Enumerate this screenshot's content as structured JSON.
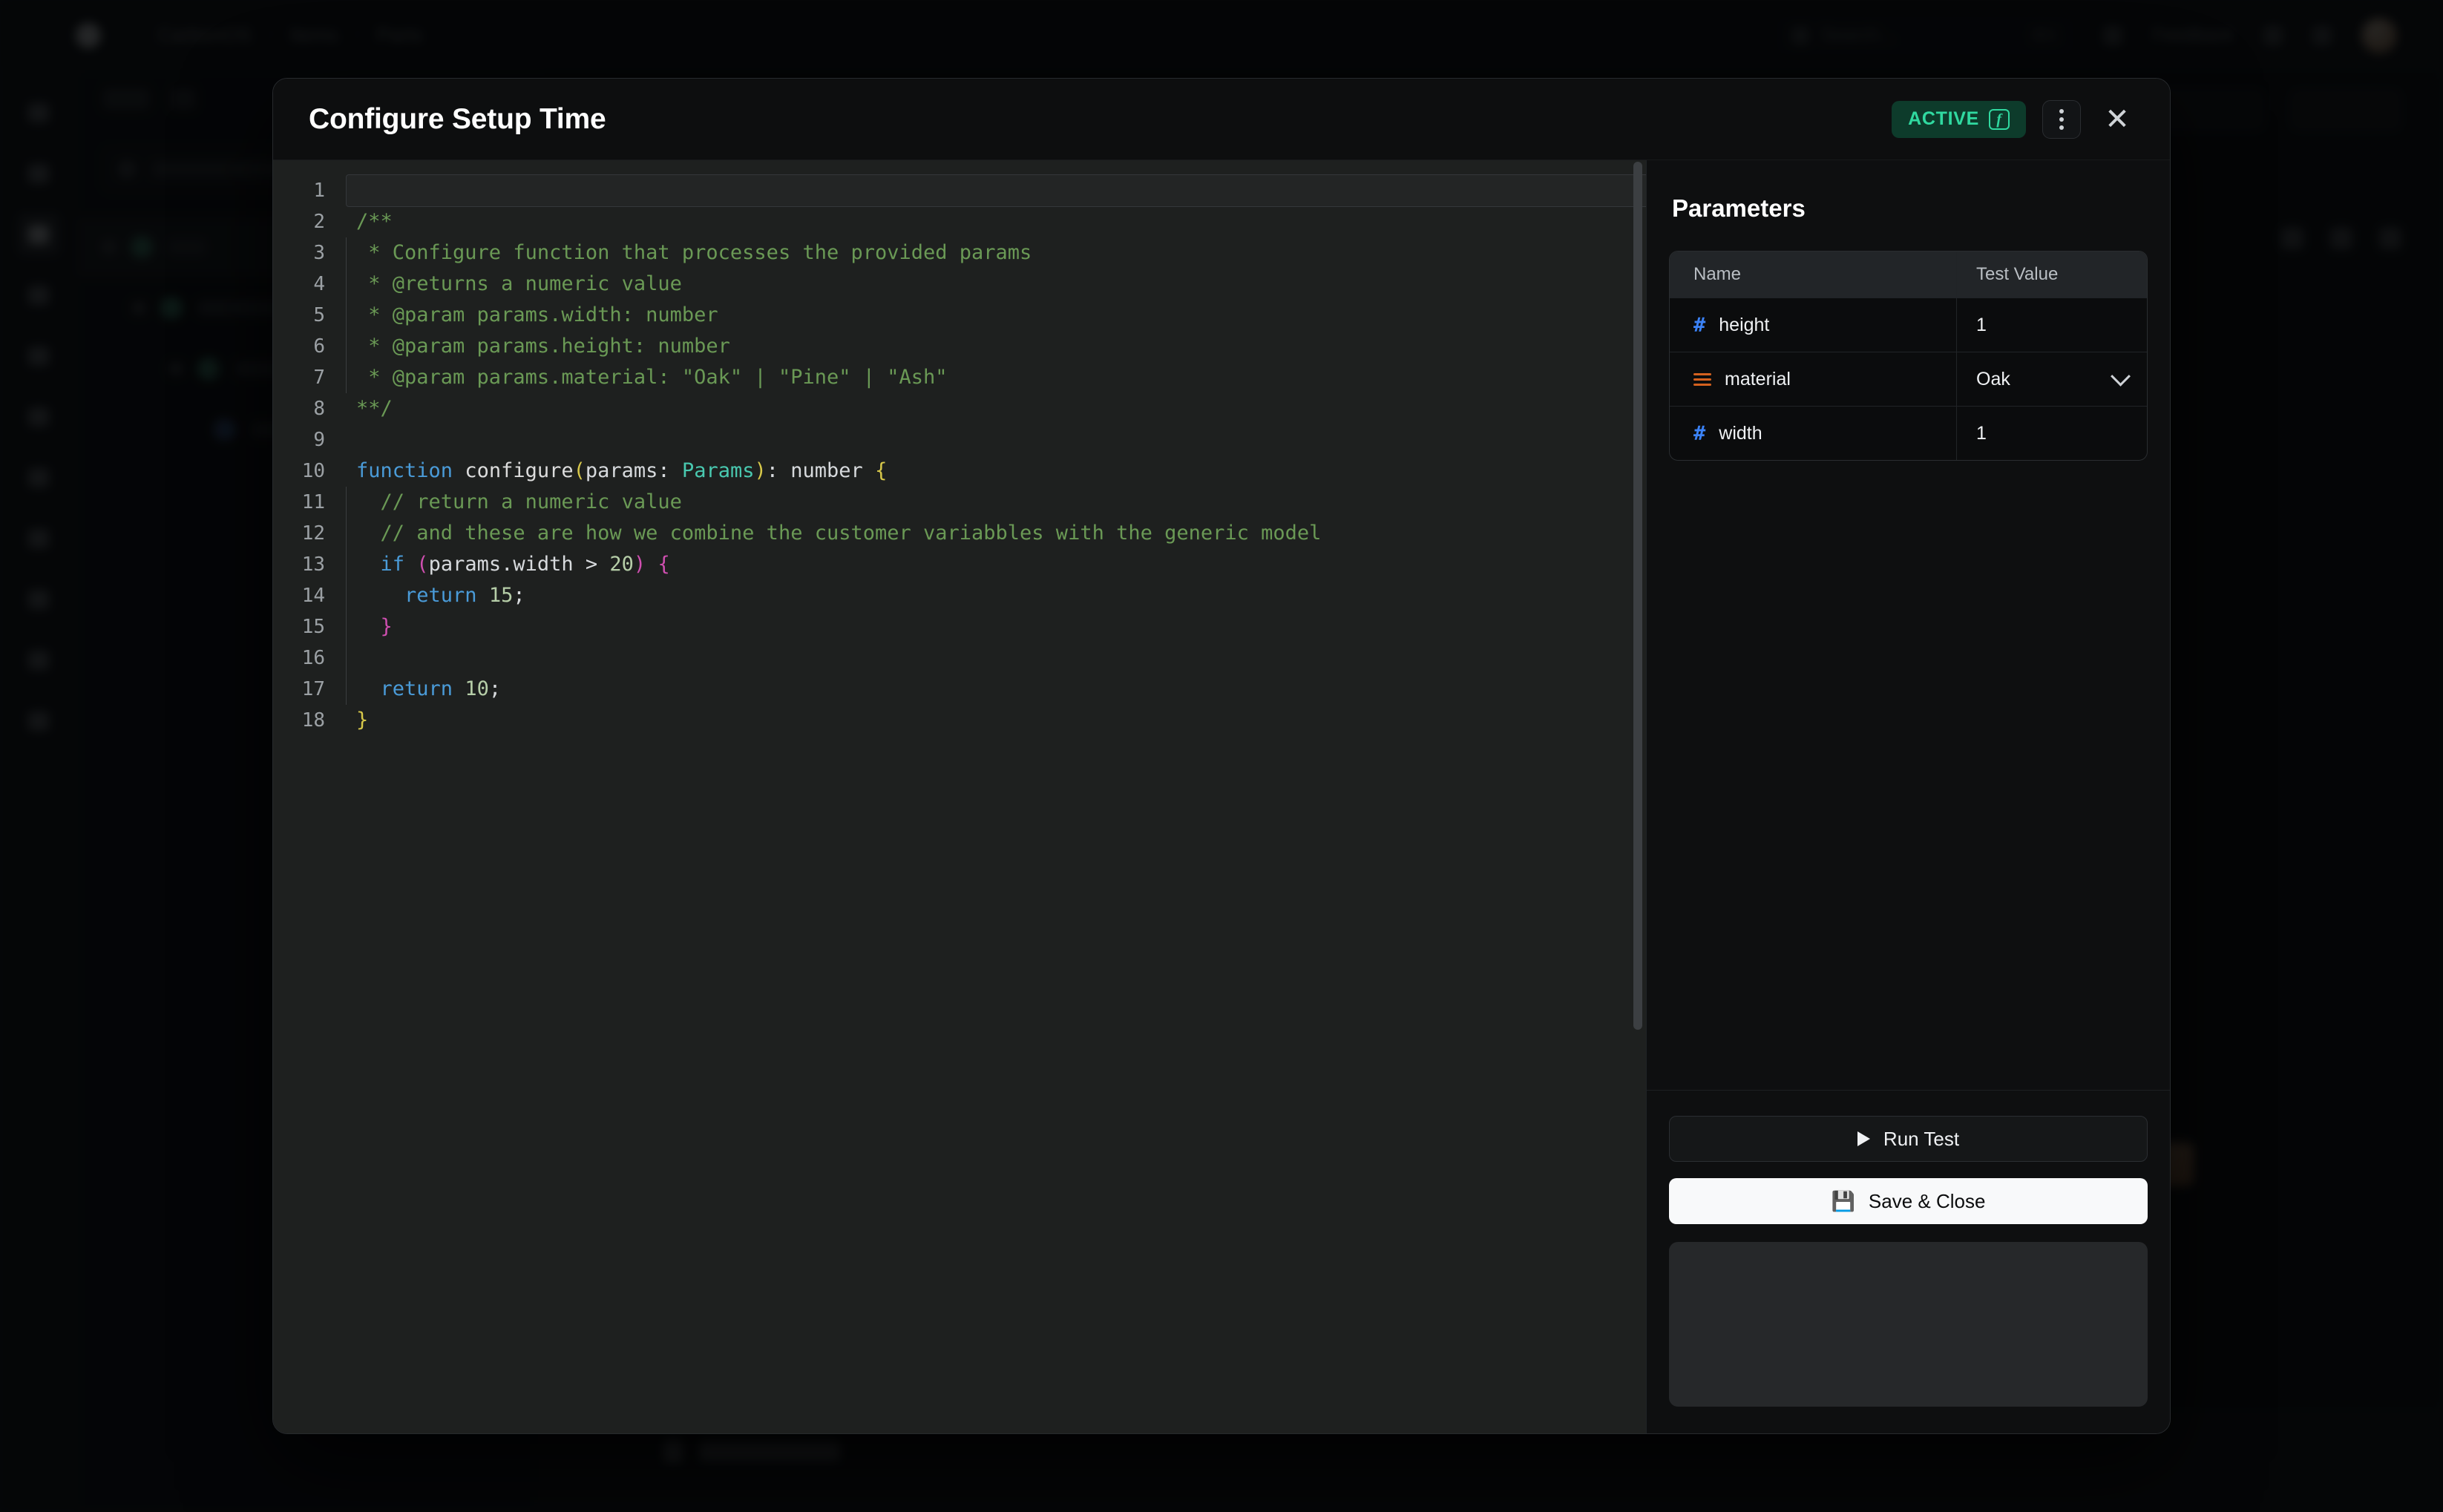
{
  "background": {
    "topbar": {
      "logo_icon": "app-logo-icon",
      "breadcrumbs": [
        "CarbonOS",
        "Items",
        "Parts"
      ],
      "separator": "/",
      "search_placeholder": "Search...",
      "search_shortcut": "⌘K",
      "feedback_label": "Feedback",
      "icons": [
        "notification-bell-icon",
        "help-circle-icon"
      ],
      "avatar": "user-avatar"
    },
    "rail_items": [
      "rail-item-1",
      "rail-item-2",
      "rail-item-3",
      "rail-item-4",
      "rail-item-5",
      "rail-item-6",
      "rail-item-7",
      "rail-item-8",
      "rail-item-9",
      "rail-item-10",
      "rail-item-11"
    ],
    "rail_active_index": 2,
    "panel": {
      "search_placeholder": "Search...",
      "tree_rows": 4
    },
    "bottombar": {
      "label": "Machine"
    }
  },
  "modal": {
    "title": "Configure Setup Time",
    "status_badge": {
      "label": "ACTIVE",
      "icon_glyph": "f",
      "color": "#30d9a0",
      "background": "#0d3b2b"
    },
    "menu_button": "more-options",
    "close_button": "close"
  },
  "editor": {
    "line_numbers": [
      1,
      2,
      3,
      4,
      5,
      6,
      7,
      8,
      9,
      10,
      11,
      12,
      13,
      14,
      15,
      16,
      17,
      18
    ],
    "active_line": 1,
    "lines": [
      {
        "n": 1,
        "indent": false,
        "tokens": []
      },
      {
        "n": 2,
        "indent": false,
        "tokens": [
          {
            "t": "/**",
            "c": "cmt"
          }
        ]
      },
      {
        "n": 3,
        "indent": true,
        "tokens": [
          {
            "t": " * Configure function that processes the provided params",
            "c": "cmt"
          }
        ]
      },
      {
        "n": 4,
        "indent": true,
        "tokens": [
          {
            "t": " * @returns a numeric value",
            "c": "cmt"
          }
        ]
      },
      {
        "n": 5,
        "indent": true,
        "tokens": [
          {
            "t": " * @param params.width: number",
            "c": "cmt"
          }
        ]
      },
      {
        "n": 6,
        "indent": true,
        "tokens": [
          {
            "t": " * @param params.height: number",
            "c": "cmt"
          }
        ]
      },
      {
        "n": 7,
        "indent": true,
        "tokens": [
          {
            "t": " * @param params.material: \"Oak\" | \"Pine\" | \"Ash\"",
            "c": "cmt"
          }
        ]
      },
      {
        "n": 8,
        "indent": false,
        "tokens": [
          {
            "t": "**/",
            "c": "cmt"
          }
        ]
      },
      {
        "n": 9,
        "indent": false,
        "tokens": []
      },
      {
        "n": 10,
        "indent": false,
        "tokens": [
          {
            "t": "function ",
            "c": "kw"
          },
          {
            "t": "configure",
            "c": "fnm"
          },
          {
            "t": "(",
            "c": "pun-y"
          },
          {
            "t": "params: ",
            "c": "plain"
          },
          {
            "t": "Params",
            "c": "typ"
          },
          {
            "t": ")",
            "c": "pun-y"
          },
          {
            "t": ": number ",
            "c": "plain"
          },
          {
            "t": "{",
            "c": "pun-y"
          }
        ]
      },
      {
        "n": 11,
        "indent": true,
        "tokens": [
          {
            "t": "  // return a numeric value",
            "c": "cmt"
          }
        ]
      },
      {
        "n": 12,
        "indent": true,
        "tokens": [
          {
            "t": "  // and these are how we combine the customer variabbles with the generic model",
            "c": "cmt"
          }
        ]
      },
      {
        "n": 13,
        "indent": true,
        "tokens": [
          {
            "t": "  ",
            "c": "plain"
          },
          {
            "t": "if ",
            "c": "kw"
          },
          {
            "t": "(",
            "c": "pun-p"
          },
          {
            "t": "params.width > ",
            "c": "plain"
          },
          {
            "t": "20",
            "c": "num"
          },
          {
            "t": ")",
            "c": "pun-p"
          },
          {
            "t": " ",
            "c": "plain"
          },
          {
            "t": "{",
            "c": "pun-p"
          }
        ]
      },
      {
        "n": 14,
        "indent": true,
        "tokens": [
          {
            "t": "    ",
            "c": "plain"
          },
          {
            "t": "return ",
            "c": "kw"
          },
          {
            "t": "15",
            "c": "num"
          },
          {
            "t": ";",
            "c": "plain"
          }
        ]
      },
      {
        "n": 15,
        "indent": true,
        "tokens": [
          {
            "t": "  ",
            "c": "plain"
          },
          {
            "t": "}",
            "c": "pun-p"
          }
        ]
      },
      {
        "n": 16,
        "indent": true,
        "tokens": []
      },
      {
        "n": 17,
        "indent": true,
        "tokens": [
          {
            "t": "  ",
            "c": "plain"
          },
          {
            "t": "return ",
            "c": "kw"
          },
          {
            "t": "10",
            "c": "num"
          },
          {
            "t": ";",
            "c": "plain"
          }
        ]
      },
      {
        "n": 18,
        "indent": false,
        "tokens": [
          {
            "t": "}",
            "c": "pun-y"
          }
        ]
      }
    ]
  },
  "parameters": {
    "heading": "Parameters",
    "columns": [
      "Name",
      "Test Value"
    ],
    "rows": [
      {
        "icon": "hash-icon",
        "type": "number",
        "name": "height",
        "value": "1",
        "control": "text"
      },
      {
        "icon": "list-icon",
        "type": "enum",
        "name": "material",
        "value": "Oak",
        "control": "select"
      },
      {
        "icon": "hash-icon",
        "type": "number",
        "name": "width",
        "value": "1",
        "control": "text"
      }
    ]
  },
  "actions": {
    "run_test": {
      "label": "Run Test",
      "icon": "play-icon"
    },
    "save_close": {
      "label": "Save & Close",
      "icon": "save-icon"
    },
    "output": ""
  }
}
